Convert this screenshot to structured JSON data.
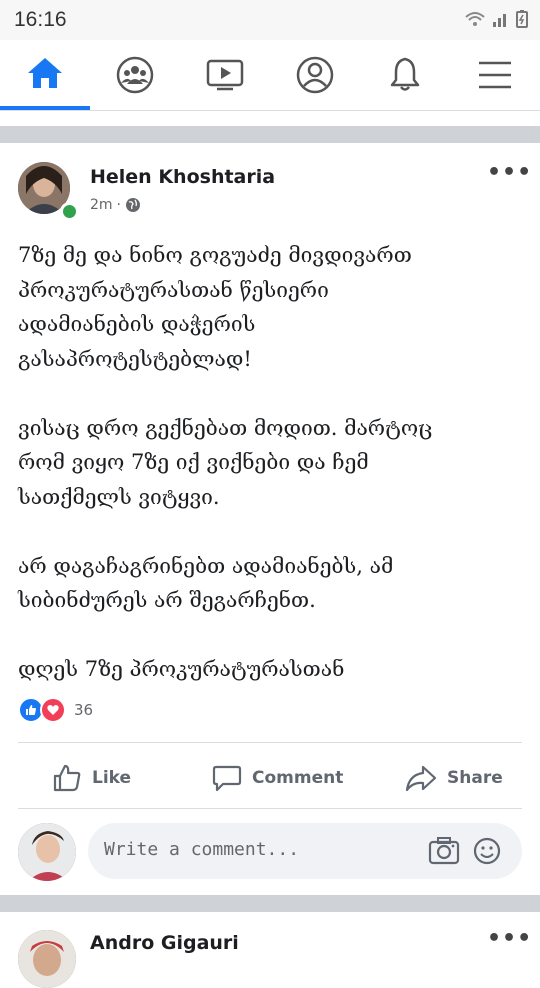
{
  "status_bar": {
    "time": "16:16",
    "icons": [
      "wifi-icon",
      "signal-icon",
      "battery-icon"
    ]
  },
  "nav": {
    "items": [
      "home-icon",
      "groups-icon",
      "watch-icon",
      "profile-icon",
      "notifications-icon",
      "menu-icon"
    ],
    "active": "home-icon",
    "accent": "#1877f2"
  },
  "post": {
    "author": "Helen Khoshtaria",
    "time": "2m",
    "privacy_icon": "globe-icon",
    "more": "•••",
    "text": "7ზე მე და ნინო გოგუაძე მივდივართ\nპროკურატურასთან წესიერი\nადამიანების დაჭერის\nგასაპროტესტებლად!\n\nვისაც დრო გექნებათ მოდით. მარტოც\nრომ ვიყო 7ზე იქ ვიქნები და ჩემ\nსათქმელს ვიტყვი.\n\nარ დაგაჩაგრინებთ ადამიანებს, ამ\nსიბინძურეს არ შეგარჩენთ.\n\nდღეს 7ზე პროკურატურასთან",
    "reactions": {
      "types": [
        "like-reaction-icon",
        "love-reaction-icon"
      ],
      "count": "36"
    },
    "actions": {
      "like": "Like",
      "comment": "Comment",
      "share": "Share"
    },
    "comment_placeholder": "Write a comment..."
  },
  "next_post": {
    "author": "Andro Gigauri",
    "more": "•••"
  }
}
